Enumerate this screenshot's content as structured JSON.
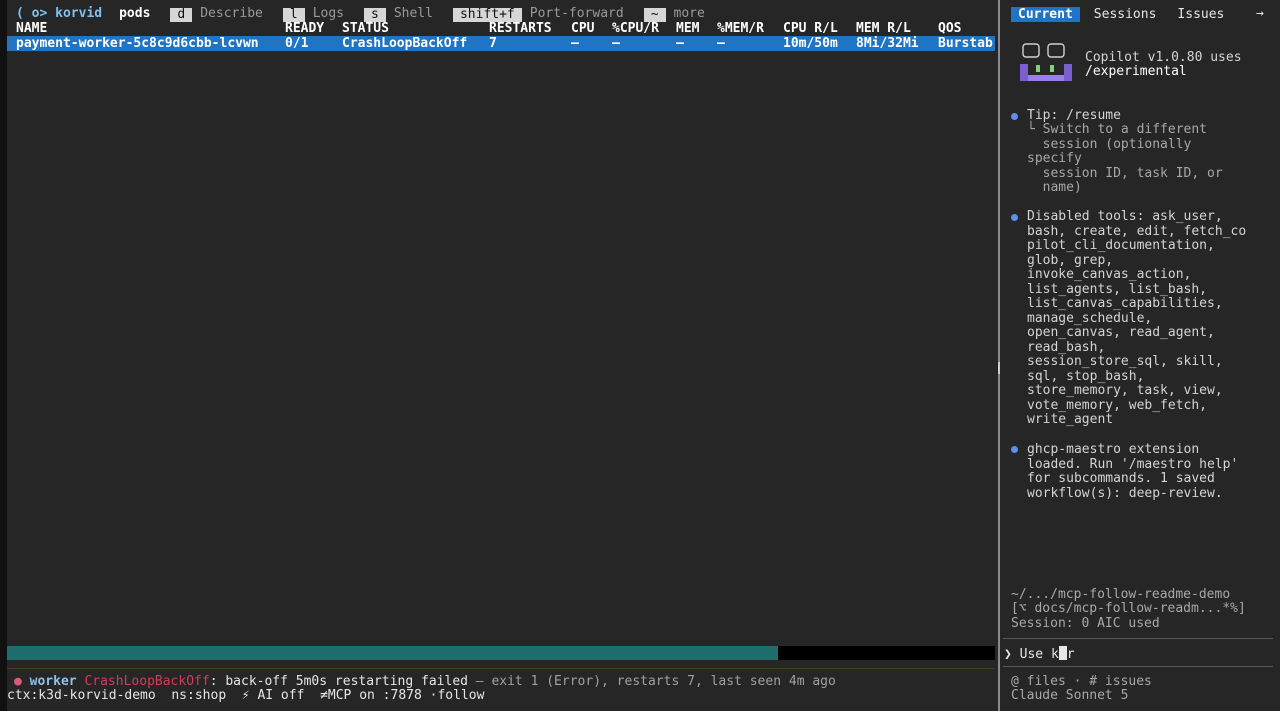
{
  "menu": {
    "brand": "( o> korvid",
    "view": "pods",
    "items": [
      {
        "key": "d",
        "label": "Describe"
      },
      {
        "key": "l",
        "label": "Logs"
      },
      {
        "key": "s",
        "label": "Shell"
      },
      {
        "key": "shift+f",
        "label": "Port-forward"
      },
      {
        "key": "~",
        "label": "more"
      }
    ]
  },
  "table": {
    "columns": [
      "NAME",
      "READY",
      "STATUS",
      "RESTARTS",
      "CPU",
      "%CPU/R",
      "MEM",
      "%MEM/R",
      "CPU R/L",
      "MEM R/L",
      "QOS"
    ],
    "rows": [
      [
        "payment-worker-5c8c9d6cbb-lcvwn",
        "0/1",
        "CrashLoopBackOff",
        "7",
        "–",
        "–",
        "–",
        "–",
        "10m/50m",
        "8Mi/32Mi",
        "Burstab"
      ]
    ]
  },
  "progress": {
    "fraction": 0.78
  },
  "event": {
    "dot": "●",
    "source": "worker",
    "status": "CrashLoopBackOff",
    "message": ": back-off 5m0s restarting failed",
    "detail": " – exit 1 (Error), restarts 7, last seen 4m ago"
  },
  "status_bar": "ctx:k3d-korvid-demo  ns:shop  ⚡ AI off  ≠MCP on :7878 ·follow",
  "copilot": {
    "tabs": [
      "Current",
      "Sessions",
      "Issues"
    ],
    "tab_arrow": "→",
    "version_line1": "Copilot v1.0.80 uses",
    "version_line2": "/experimental",
    "tip_title": "Tip: /resume",
    "tip_lines": [
      "└ Switch to a different",
      "  session (optionally",
      "specify",
      "  session ID, task ID, or",
      "  name)"
    ],
    "disabled_lines": [
      "Disabled tools: ask_user,",
      "bash, create, edit, fetch_co",
      "pilot_cli_documentation,",
      "glob, grep,",
      "invoke_canvas_action,",
      "list_agents, list_bash,",
      "list_canvas_capabilities,",
      "manage_schedule,",
      "open_canvas, read_agent,",
      "read_bash,",
      "session_store_sql, skill,",
      "sql, stop_bash,",
      "store_memory, task, view,",
      "vote_memory, web_fetch,",
      "write_agent"
    ],
    "ext_lines": [
      "ghcp-maestro extension",
      "loaded. Run '/maestro help'",
      "for subcommands. 1 saved",
      "workflow(s): deep-review."
    ],
    "path": "~/.../mcp-follow-readme-demo",
    "branch": "[⌥ docs/mcp-follow-readm...*%]",
    "session": "Session: 0 AIC used",
    "prompt_symbol": "❯",
    "input_before": "Use k",
    "input_after": "r",
    "footer1": "@ files · # issues",
    "footer2": "Claude Sonnet 5"
  }
}
